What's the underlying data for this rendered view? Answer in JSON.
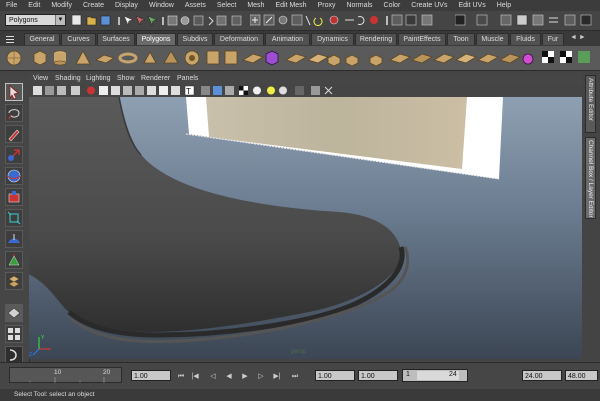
{
  "menubar": [
    "File",
    "Edit",
    "Modify",
    "Create",
    "Display",
    "Window",
    "Assets",
    "Select",
    "Mesh",
    "Edit Mesh",
    "Proxy",
    "Normals",
    "Color",
    "Create UVs",
    "Edit UVs",
    "Help"
  ],
  "status": {
    "mode": "Polygons"
  },
  "shelf_tabs": [
    "General",
    "Curves",
    "Surfaces",
    "Polygons",
    "Subdivs",
    "Deformation",
    "Animation",
    "Dynamics",
    "Rendering",
    "PaintEffects",
    "Toon",
    "Muscle",
    "Fluids",
    "Fur"
  ],
  "active_shelf": "Polygons",
  "view_menu": [
    "View",
    "Shading",
    "Lighting",
    "Show",
    "Renderer",
    "Panels"
  ],
  "viewport": {
    "camera": "persp",
    "colors": {
      "sky_top": "#8fa0b3",
      "sky_bottom": "#3c4654",
      "mesh": "#4f4f4f"
    }
  },
  "side_tabs": [
    "Attribute Editor",
    "Channel Box / Layer Editor"
  ],
  "timeline": {
    "ticks": [
      "10",
      "20"
    ],
    "current_frame": "1.00",
    "range_start": "1.00",
    "range_start2": "1.00",
    "range_inner_start": "1",
    "range_inner_end": "24",
    "range_end": "24.00",
    "range_end2": "48.00"
  },
  "help_line": "Select Tool: select an object"
}
